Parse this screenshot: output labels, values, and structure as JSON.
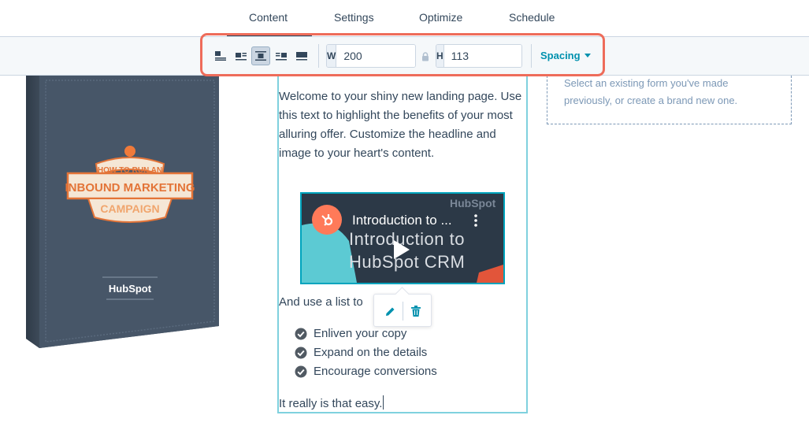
{
  "tabs": [
    {
      "label": "Content",
      "active": true
    },
    {
      "label": "Settings",
      "active": false
    },
    {
      "label": "Optimize",
      "active": false
    },
    {
      "label": "Schedule",
      "active": false
    }
  ],
  "toolbar": {
    "align_buttons": [
      "align-left-icon",
      "wrap-left-icon",
      "align-center-icon",
      "wrap-right-icon",
      "full-width-icon"
    ],
    "active_align": "align-center",
    "width": {
      "label": "W",
      "value": "200"
    },
    "height": {
      "label": "H",
      "value": "113"
    },
    "spacing_label": "Spacing",
    "highlight_color": "#ee6c5a"
  },
  "book": {
    "title_line1": "HOW TO RUN AN",
    "title_line2": "INBOUND MARKETING",
    "title_line3": "CAMPAIGN",
    "brand": "HubSpot"
  },
  "content": {
    "intro": "Welcome to your shiny new landing page. Use this text to highlight the benefits of your most alluring offer. Customize the headline and image to your heart's content.",
    "video": {
      "title": "Introduction to ...",
      "overlay_line1": "Introduction to",
      "overlay_line2": "HubSpot CRM",
      "watermark": "HubSpot"
    },
    "list_intro": "And use a list to",
    "list_items": [
      "Enliven your copy",
      "Expand on the details",
      "Encourage conversions"
    ],
    "closing": "It really is that easy."
  },
  "form_panel": {
    "text": "Select an existing form you've made previously, or create a brand new one."
  },
  "colors": {
    "accent": "#00a4bd",
    "text": "#33475b",
    "brand_orange": "#ff7a59"
  }
}
